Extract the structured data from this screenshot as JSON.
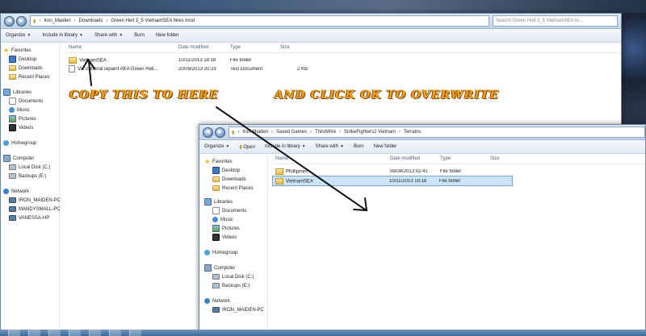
{
  "window1": {
    "address": [
      "Iron_Maiden",
      "Downloads",
      "Green Hell 3_5 VietnamSEA hires mod"
    ],
    "search_placeholder": "Search Green Hell 3_5 VietnamSEA hi...",
    "toolbar": {
      "organize": "Organize",
      "include": "Include in library",
      "share": "Share with",
      "burn": "Burn",
      "new_folder": "New folder"
    },
    "columns": {
      "name": "Name",
      "date": "Date modified",
      "type": "Type",
      "size": "Size"
    },
    "files": [
      {
        "name": "VietnamSEA",
        "date": "10/11/2013 18:18",
        "type": "File folder",
        "size": ""
      },
      {
        "name": "Vi...optional repaint AKA Green Hell...",
        "date": "20/09/2013 20:29",
        "type": "Text Document",
        "size": "2 KB"
      }
    ],
    "sidebar": {
      "favorites": "Favorites",
      "desktop": "Desktop",
      "downloads": "Downloads",
      "recent": "Recent Places",
      "libraries": "Libraries",
      "documents": "Documents",
      "music": "Music",
      "pictures": "Pictures",
      "videos": "Videos",
      "homegroup": "Homegroup",
      "computer": "Computer",
      "local_disk": "Local Disk (C:)",
      "backups": "Backups (E:)",
      "network": "Network",
      "pc1": "IRON_MAIDEN-PC",
      "pc2": "MANDYSMALL-PC",
      "pc3": "VANESSA-HP"
    }
  },
  "window2": {
    "address": [
      "Iron Maiden",
      "Saved Games",
      "ThirdWire",
      "StrikeFighters2 Vietnam",
      "Terrains"
    ],
    "toolbar": {
      "organize": "Organize",
      "open": "Open",
      "include": "Include in library",
      "share": "Share with",
      "burn": "Burn",
      "new_folder": "New folder"
    },
    "columns": {
      "name": "Name",
      "date": "Date modified",
      "type": "Type",
      "size": "Size"
    },
    "files": [
      {
        "name": "Phillipines",
        "date": "06/08/2013 02:41",
        "type": "File folder"
      },
      {
        "name": "VietnamSEA",
        "date": "10/11/2013 18:18",
        "type": "File folder"
      }
    ],
    "sidebar": {
      "favorites": "Favorites",
      "desktop": "Desktop",
      "downloads": "Downloads",
      "recent": "Recent Places",
      "libraries": "Libraries",
      "documents": "Documents",
      "music": "Music",
      "pictures": "Pictures",
      "videos": "Videos",
      "homegroup": "Homegroup",
      "computer": "Computer",
      "local_disk": "Local Disk (C:)",
      "backups": "Backups (E:)",
      "network": "Network",
      "pc1": "IRON_MAIDEN-PC"
    }
  },
  "overlay": {
    "text1": "COPY THIS TO HERE",
    "text2": "AND CLICK OK TO OVERWRITE"
  },
  "colors": {
    "overlay_text": "#f7a310",
    "selection": "#cce4f7"
  }
}
